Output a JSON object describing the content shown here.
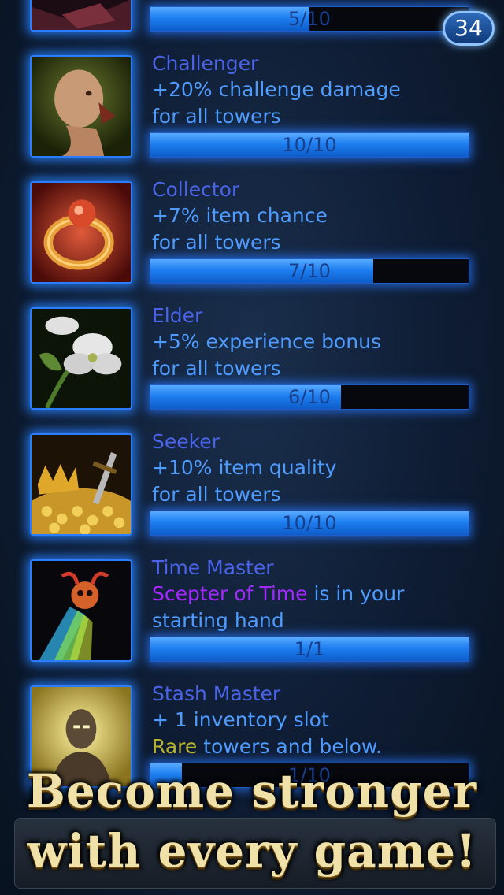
{
  "level_badge": "34",
  "talents": [
    {
      "name": "",
      "lines": [
        ""
      ],
      "progress_label": "5/10",
      "progress": 0.5,
      "icon": "partial-top-icon"
    },
    {
      "name": "Challenger",
      "lines": [
        "+20% challenge damage",
        "for all towers"
      ],
      "progress_label": "10/10",
      "progress": 1.0,
      "icon": "shouting-man-icon"
    },
    {
      "name": "Collector",
      "lines": [
        "+7% item chance",
        "for all towers"
      ],
      "progress_label": "7/10",
      "progress": 0.7,
      "icon": "ring-icon"
    },
    {
      "name": "Elder",
      "lines": [
        "+5% experience bonus",
        "for all towers"
      ],
      "progress_label": "6/10",
      "progress": 0.6,
      "icon": "flower-icon"
    },
    {
      "name": "Seeker",
      "lines": [
        "+10% item quality",
        "for all towers"
      ],
      "progress_label": "10/10",
      "progress": 1.0,
      "icon": "treasure-icon"
    },
    {
      "name": "Time Master",
      "lines": [
        "Scepter of Time",
        " is in your",
        "starting hand"
      ],
      "progress_label": "1/1",
      "progress": 1.0,
      "icon": "scepter-icon"
    },
    {
      "name": "Stash Master",
      "lines": [
        "+ 1 inventory slot",
        "Rare",
        " towers and below."
      ],
      "progress_label": "1/10",
      "progress": 0.1,
      "icon": "glowing-man-icon"
    }
  ],
  "banner": {
    "line1": "Become stronger",
    "line2": "with every game!"
  },
  "colors": {
    "name": "#4a63e8",
    "description": "#4f9cff",
    "highlight_purple": "#a429ff",
    "highlight_gold": "#b8b431",
    "bar_fill": "#1e7ff0"
  }
}
